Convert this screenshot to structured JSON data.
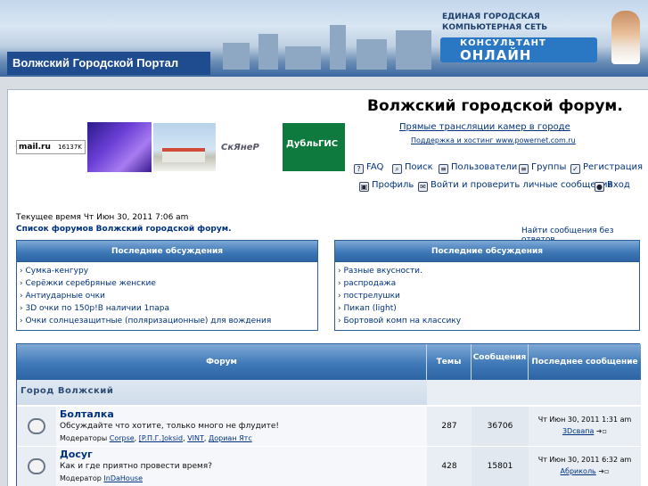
{
  "header": {
    "portal_title": "Волжский Городской Портал",
    "promo": {
      "line1": "ЕДИНАЯ ГОРОДСКАЯ",
      "line2": "КОМПЬЮТЕРНАЯ СЕТЬ",
      "line3": "КОНСУЛЬТАНТ",
      "line4": "ОНЛАЙН"
    }
  },
  "banners": {
    "mail_logo": "mail.ru",
    "mail_count": "16137K",
    "skiner": "СкЯнеР",
    "dublgis": "ДубльГИС"
  },
  "site": {
    "title": "Волжский городской форум.",
    "cams_link": "Прямые трансляции камер в городе",
    "support_link": "Поддержка и хостинг www.powernet.com.ru"
  },
  "nav": {
    "faq": "FAQ",
    "search": "Поиск",
    "users": "Пользователи",
    "groups": "Группы",
    "register": "Регистрация",
    "profile": "Профиль",
    "login": "Войти и проверить личные сообщения",
    "enter": "Вход"
  },
  "status": {
    "current_time": "Текущее время Чт Июн 30, 2011 7:06 am",
    "index_link": "Список форумов Волжский городской форум.",
    "unanswered": "Найти сообщения без ответов"
  },
  "latest_left": {
    "header": "Последние обсуждения",
    "items": [
      "Сумка-кенгуру",
      "Серёжки серебряные женские",
      "Антиударные очки",
      "3D очки по 150р!В наличии 1пара",
      "Очки солнцезащитные (поляризационные) для вождения"
    ]
  },
  "latest_right": {
    "header": "Последние обсуждения",
    "items": [
      "Разные вкусности.",
      "распродажа",
      "пострелушки",
      "Пикап (light)",
      "Бортовой комп на классику"
    ]
  },
  "table": {
    "col_forum": "Форум",
    "col_topics": "Темы",
    "col_posts": "Сообщения",
    "col_last": "Последнее сообщение",
    "category": "Город Волжский",
    "rows": [
      {
        "name": "Болталка",
        "desc": "Обсуждайте что хотите, только много не флудите!",
        "mods_label": "Модераторы",
        "mods": [
          "Corpse",
          "[P.П.Г.]oksid",
          "VINT",
          "Дориан Ятс"
        ],
        "topics": "287",
        "posts": "36706",
        "last_date": "Чт Июн 30, 2011 1:31 am",
        "last_user": "3Dсвапа"
      },
      {
        "name": "Досуг",
        "desc": "Как и где приятно провести время?",
        "mods_label": "Модератор",
        "mods": [
          "InDaHouse"
        ],
        "topics": "428",
        "posts": "15801",
        "last_date": "Чт Июн 30, 2011 6:32 am",
        "last_user": "Абриколь"
      }
    ]
  },
  "colors": {
    "link": "#00327f",
    "header_blue": "#3f79b7",
    "border": "#2d5e95"
  }
}
